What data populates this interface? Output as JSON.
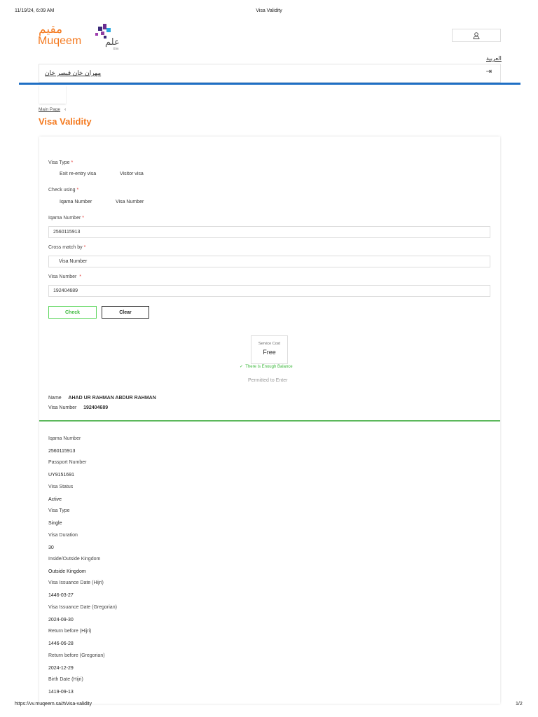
{
  "print_header": {
    "datetime": "11/19/24, 6:09 AM",
    "title": "Visa Validity"
  },
  "print_footer": {
    "url": "https://vv.muqeem.sa/#/visa-validity",
    "page": "1/2"
  },
  "brand": {
    "logo_ar": "مقيم",
    "logo_en": "Muqeem",
    "elm_logo": "علم",
    "elm_sub": "Elm",
    "color": "#f47a20"
  },
  "header": {
    "language_link": "العربية",
    "user_name": "مهران خان قيصر خان",
    "user_icon": "user-icon",
    "logout_icon": "logout-icon"
  },
  "breadcrumb": {
    "home": "Main Page",
    "separator": "‹"
  },
  "page_title": "Visa Validity",
  "form": {
    "visa_type": {
      "label": "Visa Type",
      "options": [
        "Exit re-entry visa",
        "Visitor visa"
      ]
    },
    "check_using": {
      "label": "Check using",
      "options": [
        "Iqama Number",
        "Visa Number"
      ]
    },
    "iqama": {
      "label": "Iqama Number",
      "value": "2560115913"
    },
    "cross_match": {
      "label": "Cross match by",
      "value": "Visa Number"
    },
    "visa_number": {
      "label": "Visa Number",
      "value": "192404689"
    },
    "required_mark": "*",
    "check_label": "Check",
    "clear_label": "Clear"
  },
  "result": {
    "service_cost_label": "Service Cost",
    "service_cost_value": "Free",
    "balance_msg": "There is Enough Balance",
    "check_icon": "✓",
    "status": "Permitted to Enter",
    "name_label": "Name",
    "name_value": "AHAD UR RAHMAN ABDUR RAHMAN",
    "visa_number_label": "Visa Number",
    "visa_number_value": "192404689",
    "colors": {
      "success": "#5cb85c"
    }
  },
  "details": [
    {
      "label": "Iqama Number",
      "value": "2560115913"
    },
    {
      "label": "Passport Number",
      "value": "UY9151691"
    },
    {
      "label": "Visa Status",
      "value": "Active"
    },
    {
      "label": "Visa Type",
      "value": "Single"
    },
    {
      "label": "Visa Duration",
      "value": "30"
    },
    {
      "label": "Inside/Outside Kingdom",
      "value": "Outside Kingdom"
    },
    {
      "label": "Visa Issuance Date (Hijri)",
      "value": "1446-03-27"
    },
    {
      "label": "Visa Issuance Date (Gregorian)",
      "value": "2024-09-30"
    },
    {
      "label": "Return before (Hijri)",
      "value": "1446-06-28"
    },
    {
      "label": "Return before (Gregorian)",
      "value": "2024-12-29"
    },
    {
      "label": "Birth Date (Hijri)",
      "value": "1419-09-13"
    }
  ]
}
